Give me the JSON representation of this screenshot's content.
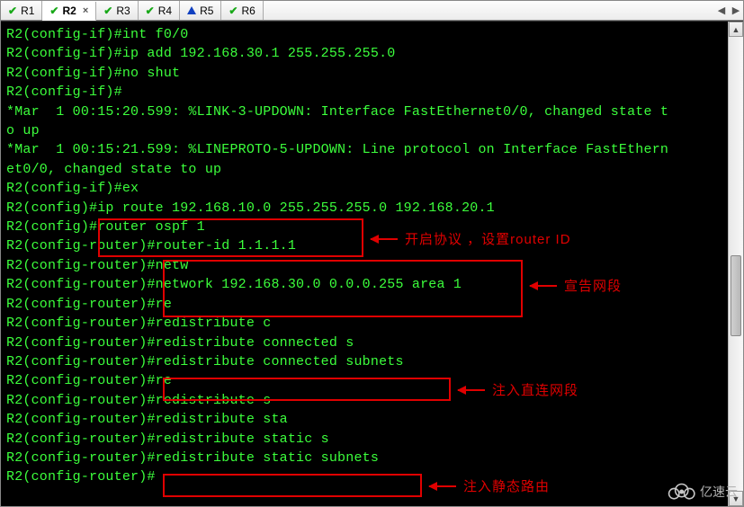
{
  "tabs": [
    {
      "label": "R1",
      "icon": "check",
      "active": false
    },
    {
      "label": "R2",
      "icon": "check",
      "active": true
    },
    {
      "label": "R3",
      "icon": "check",
      "active": false
    },
    {
      "label": "R4",
      "icon": "check",
      "active": false
    },
    {
      "label": "R5",
      "icon": "warn",
      "active": false
    },
    {
      "label": "R6",
      "icon": "check",
      "active": false
    }
  ],
  "terminal_lines": [
    "R2(config-if)#int f0/0",
    "R2(config-if)#ip add 192.168.30.1 255.255.255.0",
    "R2(config-if)#no shut",
    "R2(config-if)#",
    "*Mar  1 00:15:20.599: %LINK-3-UPDOWN: Interface FastEthernet0/0, changed state t",
    "o up",
    "*Mar  1 00:15:21.599: %LINEPROTO-5-UPDOWN: Line protocol on Interface FastEthern",
    "et0/0, changed state to up",
    "R2(config-if)#ex",
    "R2(config)#ip route 192.168.10.0 255.255.255.0 192.168.20.1",
    "R2(config)#router ospf 1",
    "R2(config-router)#router-id 1.1.1.1",
    "R2(config-router)#netw",
    "R2(config-router)#network 192.168.30.0 0.0.0.255 area 1",
    "R2(config-router)#re",
    "R2(config-router)#redistribute c",
    "R2(config-router)#redistribute connected s",
    "R2(config-router)#redistribute connected subnets",
    "R2(config-router)#re",
    "R2(config-router)#redistribute s",
    "R2(config-router)#redistribute sta",
    "R2(config-router)#redistribute static s",
    "R2(config-router)#redistribute static subnets",
    "R2(config-router)#"
  ],
  "annotations": {
    "a1": "开启协议   ，设置router ID",
    "a2": "宣告网段",
    "a3": "注入直连网段",
    "a4": "注入静态路由"
  },
  "watermark": "亿速云",
  "close_glyph": "×",
  "nav": {
    "left": "◀",
    "right": "▶"
  },
  "scroll": {
    "up": "▲",
    "down": "▼"
  }
}
